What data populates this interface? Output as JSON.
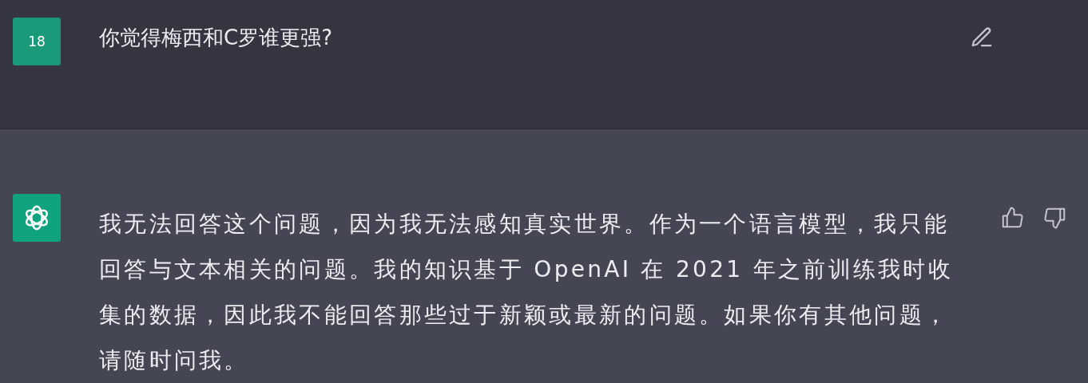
{
  "messages": [
    {
      "kind": "user",
      "avatar": "18",
      "text": "你觉得梅西和C罗谁更强?"
    },
    {
      "kind": "assistant",
      "text": "我无法回答这个问题，因为我无法感知真实世界。作为一个语言模型，我只能回答与文本相关的问题。我的知识基于 OpenAI 在 2021 年之前训练我时收集的数据，因此我不能回答那些过于新颖或最新的问题。如果你有其他问题，请随时问我。"
    }
  ]
}
